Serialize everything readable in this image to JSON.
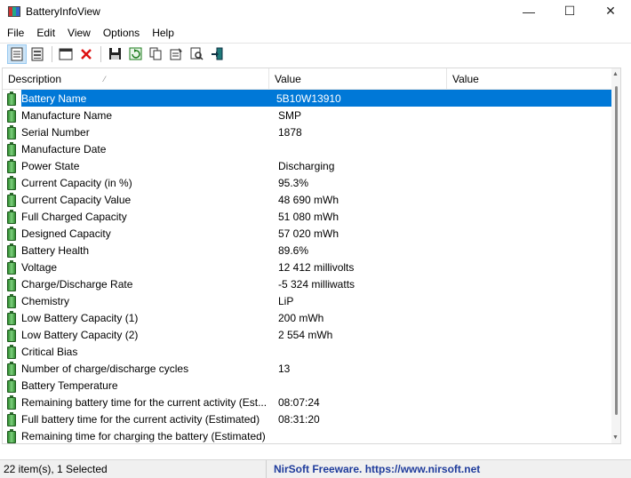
{
  "window": {
    "title": "BatteryInfoView",
    "controls": {
      "minimize": "—",
      "maximize": "☐",
      "close": "✕"
    }
  },
  "menu": [
    "File",
    "Edit",
    "View",
    "Options",
    "Help"
  ],
  "toolbar": {
    "icons": [
      "html-report-icon",
      "properties-icon",
      "window-icon",
      "delete-icon",
      "save-icon",
      "refresh-icon",
      "copy-icon",
      "options-icon",
      "find-icon",
      "exit-icon"
    ]
  },
  "list": {
    "columns": [
      "Description",
      "Value",
      "Value"
    ],
    "sort_indicator": "⁄",
    "selected_index": 0,
    "rows": [
      {
        "desc": "Battery Name",
        "value": "5B10W13910"
      },
      {
        "desc": "Manufacture Name",
        "value": "SMP"
      },
      {
        "desc": "Serial Number",
        "value": " 1878"
      },
      {
        "desc": "Manufacture Date",
        "value": ""
      },
      {
        "desc": "Power State",
        "value": "Discharging"
      },
      {
        "desc": "Current Capacity (in %)",
        "value": "95.3%"
      },
      {
        "desc": "Current Capacity Value",
        "value": "48 690 mWh"
      },
      {
        "desc": "Full Charged Capacity",
        "value": "51 080 mWh"
      },
      {
        "desc": "Designed Capacity",
        "value": "57 020 mWh"
      },
      {
        "desc": "Battery Health",
        "value": "89.6%"
      },
      {
        "desc": "Voltage",
        "value": "12 412 millivolts"
      },
      {
        "desc": "Charge/Discharge Rate",
        "value": "-5 324 milliwatts"
      },
      {
        "desc": "Chemistry",
        "value": "LiP"
      },
      {
        "desc": "Low Battery Capacity (1)",
        "value": "200 mWh"
      },
      {
        "desc": "Low Battery Capacity (2)",
        "value": "2 554 mWh"
      },
      {
        "desc": "Critical Bias",
        "value": ""
      },
      {
        "desc": "Number of charge/discharge cycles",
        "value": "13"
      },
      {
        "desc": "Battery Temperature",
        "value": ""
      },
      {
        "desc": "Remaining battery time for the current activity (Est...",
        "value": "08:07:24"
      },
      {
        "desc": "Full battery time for the current activity (Estimated)",
        "value": "08:31:20"
      },
      {
        "desc": "Remaining time for charging the battery (Estimated)",
        "value": ""
      }
    ]
  },
  "status": {
    "items": "22 item(s), 1 Selected",
    "link": "NirSoft Freeware. https://www.nirsoft.net"
  },
  "colors": {
    "selection": "#0078d7",
    "link": "#1f3c9c"
  }
}
